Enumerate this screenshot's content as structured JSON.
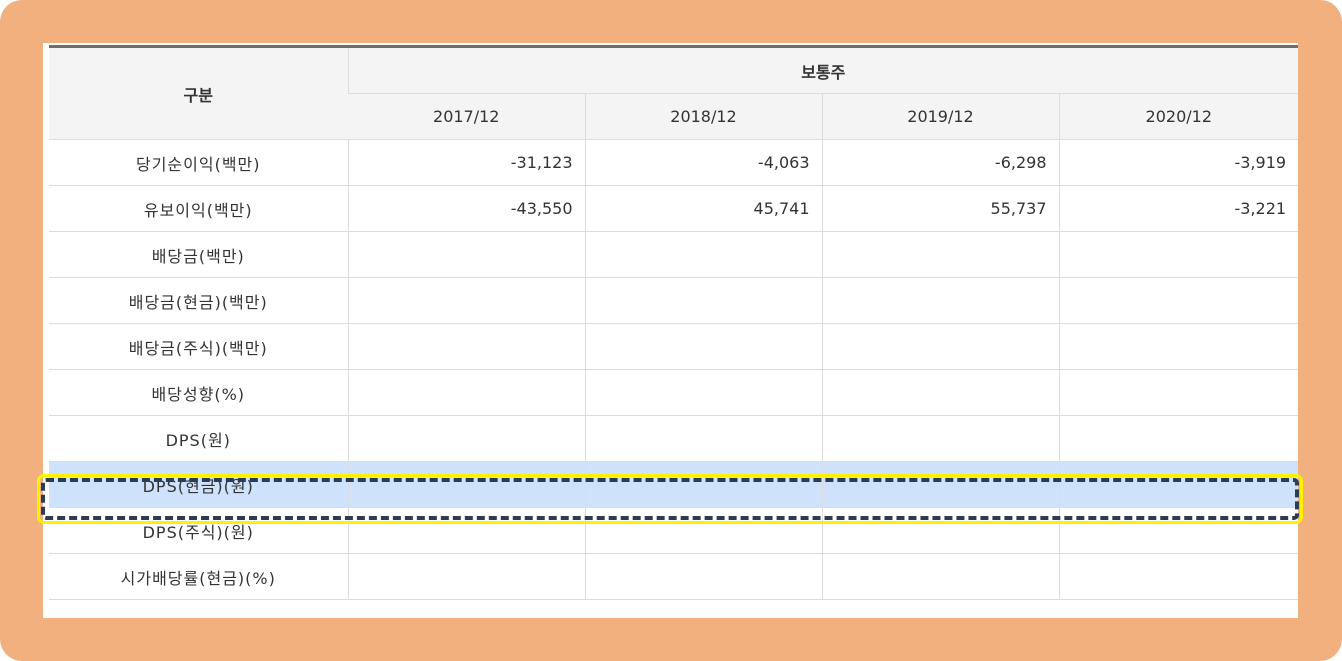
{
  "table": {
    "header": {
      "category": "구분",
      "group": "보통주",
      "periods": [
        "2017/12",
        "2018/12",
        "2019/12",
        "2020/12"
      ]
    },
    "rows": [
      {
        "label": "당기순이익(백만)",
        "values": [
          "-31,123",
          "-4,063",
          "-6,298",
          "-3,919"
        ]
      },
      {
        "label": "유보이익(백만)",
        "values": [
          "-43,550",
          "45,741",
          "55,737",
          "-3,221"
        ]
      },
      {
        "label": "배당금(백만)",
        "values": [
          "",
          "",
          "",
          ""
        ]
      },
      {
        "label": "배당금(현금)(백만)",
        "values": [
          "",
          "",
          "",
          ""
        ]
      },
      {
        "label": "배당금(주식)(백만)",
        "values": [
          "",
          "",
          "",
          ""
        ]
      },
      {
        "label": "배당성향(%)",
        "values": [
          "",
          "",
          "",
          ""
        ]
      },
      {
        "label": "DPS(원)",
        "values": [
          "",
          "",
          "",
          ""
        ]
      },
      {
        "label": "DPS(현금)(원)",
        "values": [
          "",
          "",
          "",
          ""
        ]
      },
      {
        "label": "DPS(주식)(원)",
        "values": [
          "",
          "",
          "",
          ""
        ]
      },
      {
        "label": "시가배당률(현금)(%)",
        "values": [
          "",
          "",
          "",
          ""
        ]
      }
    ]
  },
  "highlight": {
    "row_label": "DPS(현금)(원)",
    "color": "#cfe2fb"
  },
  "colors": {
    "frame": "#f2b07f",
    "outline_yellow": "#fff200",
    "outline_dash": "#2a3d55"
  }
}
